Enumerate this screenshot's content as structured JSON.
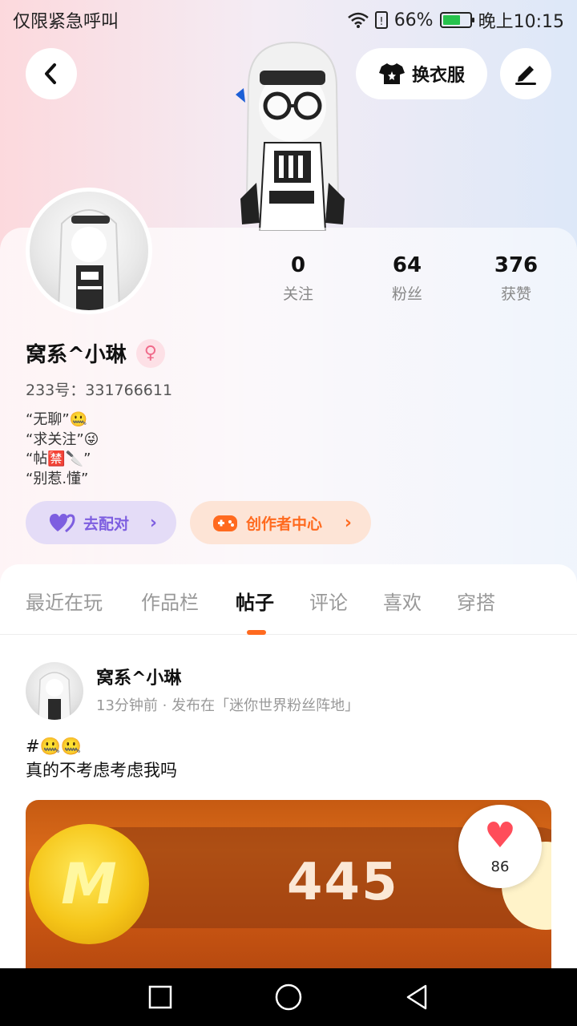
{
  "status_bar": {
    "carrier": "仅限紧急呼叫",
    "battery_percent": "66%",
    "time": "晚上10:15",
    "battery_level": 0.66
  },
  "header": {
    "back_icon": "chevron-left-icon",
    "dress_label": "换衣服",
    "dress_icon": "shirt-icon",
    "edit_icon": "pen-icon"
  },
  "profile": {
    "stats": [
      {
        "value": "0",
        "label": "关注"
      },
      {
        "value": "64",
        "label": "粉丝"
      },
      {
        "value": "376",
        "label": "获赞"
      }
    ],
    "name": "窝系^小琳",
    "gender_icon": "female-icon",
    "uid": "233号：331766611",
    "bio": [
      "“无聊”🤐",
      "“求关注”😜",
      "“帖🈲🔪”",
      "“别惹.懂”"
    ],
    "match_label": "去配对",
    "creator_label": "创作者中心"
  },
  "tabs": {
    "items": [
      "最近在玩",
      "作品栏",
      "帖子",
      "评论",
      "喜欢",
      "穿搭"
    ],
    "active": "帖子"
  },
  "post": {
    "author": "窝系^小琳",
    "meta": "13分钟前 · 发布在「迷你世界粉丝阵地」",
    "text_line1": "#🤐🤐",
    "text_line2": "真的不考虑考虑我吗",
    "image_count": "445",
    "image_coin_letter": "M",
    "likes": "86"
  },
  "colors": {
    "accent": "#ff6a1f",
    "match_purple": "#7d5ee0",
    "like_red": "#ff4d5a"
  }
}
